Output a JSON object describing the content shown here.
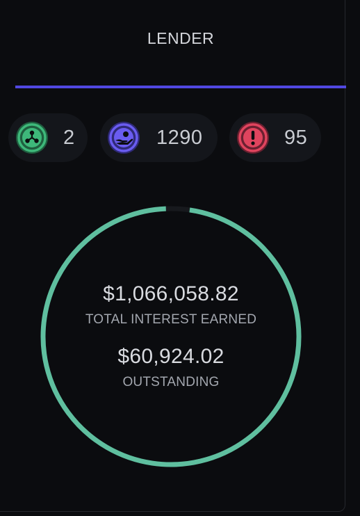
{
  "tab": {
    "label": "LENDER",
    "accent_color": "#5148e0"
  },
  "stats": [
    {
      "icon": "nodes-icon",
      "count": "2",
      "color": "#3eb87a"
    },
    {
      "icon": "hand-coin-icon",
      "count": "1290",
      "color": "#6a5cf0"
    },
    {
      "icon": "alert-icon",
      "count": "95",
      "color": "#e0445e"
    }
  ],
  "summary": {
    "ring_progress": 0.97,
    "ring_color": "#5fbf9f",
    "interest_amount": "$1,066,058.82",
    "interest_label": "TOTAL INTEREST EARNED",
    "outstanding_amount": "$60,924.02",
    "outstanding_label": "OUTSTANDING"
  }
}
